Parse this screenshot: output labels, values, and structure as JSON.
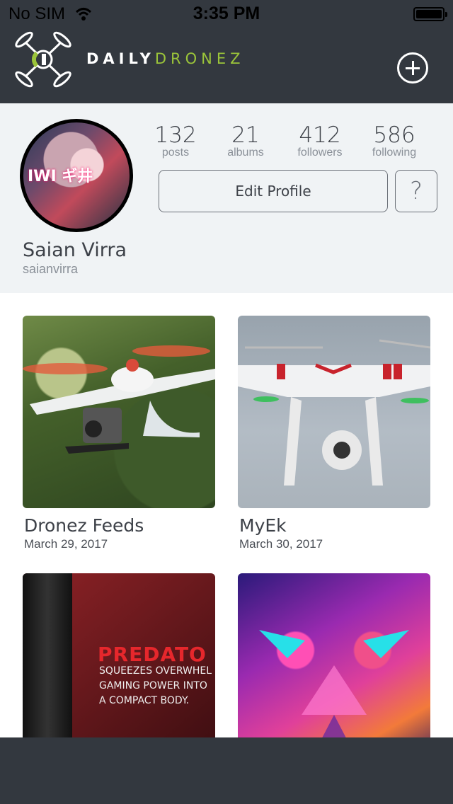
{
  "status_bar": {
    "carrier": "No SIM",
    "time": "3:35 PM"
  },
  "header": {
    "brand_part1": "DAILY",
    "brand_part2": "DRONEZ",
    "accent_color": "#9bc43a"
  },
  "profile": {
    "stats": [
      {
        "value": "132",
        "label": "posts"
      },
      {
        "value": "21",
        "label": "albums"
      },
      {
        "value": "412",
        "label": "followers"
      },
      {
        "value": "586",
        "label": "following"
      }
    ],
    "edit_label": "Edit Profile",
    "help_label": "?",
    "avatar_text": "IWI ギ井",
    "name": "Saian Virra",
    "username": "saianvirra"
  },
  "albums": [
    {
      "title": "Dronez Feeds",
      "date": "March 29, 2017"
    },
    {
      "title": "MyEk",
      "date": "March 30, 2017"
    },
    {
      "title": "",
      "date": "",
      "overlay_title": "PREDATO",
      "overlay_lines": [
        "SQUEEZES OVERWHEL",
        "GAMING POWER INTO",
        "A COMPACT BODY."
      ]
    },
    {
      "title": "",
      "date": ""
    }
  ]
}
